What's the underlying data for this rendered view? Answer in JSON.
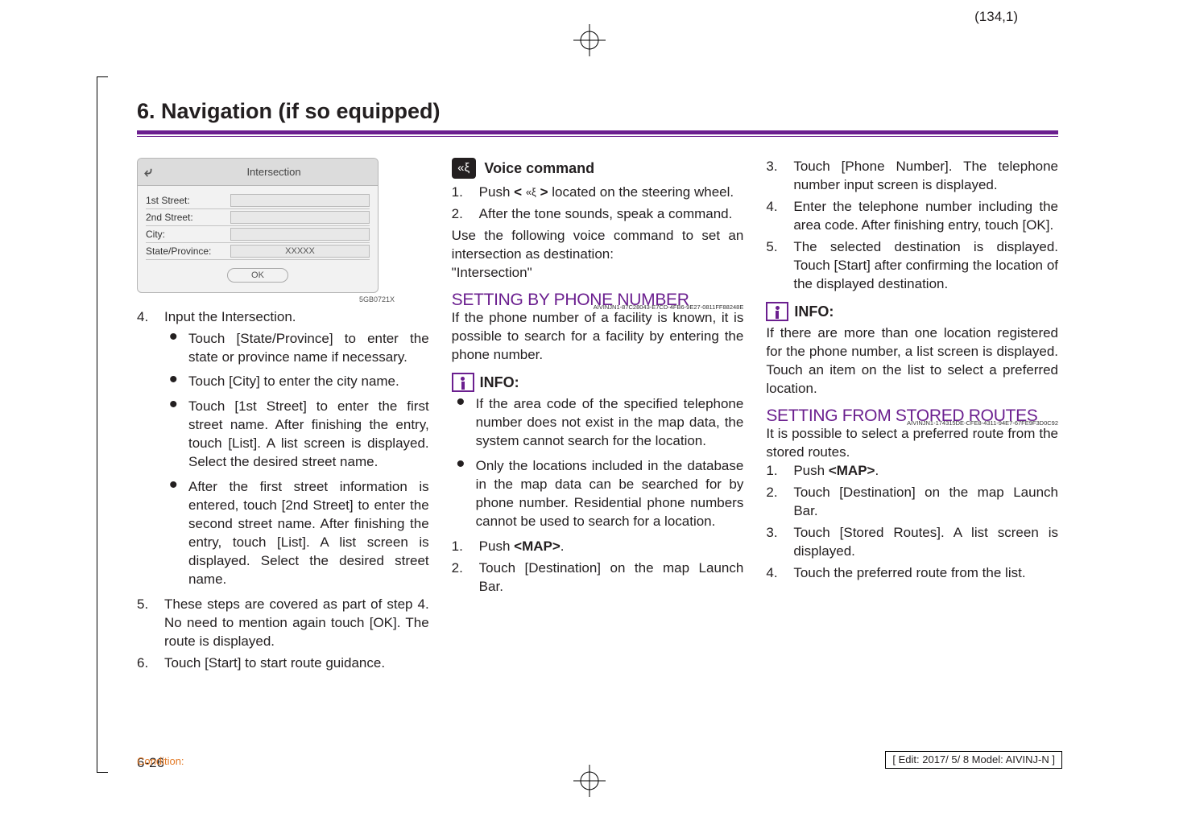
{
  "page_coord": "(134,1)",
  "chapter_title": "6. Navigation (if so equipped)",
  "screenshot": {
    "title": "Intersection",
    "rows": [
      {
        "label": "1st Street:",
        "value": ""
      },
      {
        "label": "2nd Street:",
        "value": ""
      },
      {
        "label": "City:",
        "value": ""
      },
      {
        "label": "State/Province:",
        "value": "XXXXX"
      }
    ],
    "ok": "OK",
    "code": "5GB0721X"
  },
  "col1": {
    "step4": "Input the Intersection.",
    "b1": "Touch [State/Province] to enter the state or province name if necessary.",
    "b2": "Touch [City] to enter the city name.",
    "b3": "Touch [1st Street] to enter the first street name. After finishing the entry, touch [List]. A list screen is displayed. Select the desired street name.",
    "b4": "After the first street information is entered, touch [2nd Street] to enter the second street name. After finishing the entry, touch [List]. A list screen is displayed. Select the desired street name.",
    "step5": "These steps are covered as part of step 4. No need to mention again touch [OK]. The route is displayed.",
    "step6": "Touch [Start] to start route guidance."
  },
  "col2": {
    "voice_heading": "Voice command",
    "v1a": "Push ",
    "v1b": "< ",
    "v1c": " >",
    "v1d": " located on the steering wheel.",
    "v2": "After the tone sounds, speak a command.",
    "vp": "Use the following voice command to set an intersection as destination:",
    "vcmd": "\"Intersection\"",
    "sec_phone": "SETTING BY PHONE NUMBER",
    "sec_phone_code": "AIVINJN1-87C28043-E7CD-4FB6-9E27-0811FF88248E",
    "phone_intro": "If the phone number of a facility is known, it is possible to search for a facility by entering the phone number.",
    "info": "INFO:",
    "info_b1": "If the area code of the specified telephone number does not exist in the map data, the system cannot search for the location.",
    "info_b2": "Only the locations included in the database in the map data can be searched for by phone number. Residential phone numbers cannot be used to search for a location.",
    "p1a": "Push ",
    "p1b": "<MAP>",
    "p1c": ".",
    "p2": "Touch [Destination] on the map Launch Bar."
  },
  "col3": {
    "p3": "Touch [Phone Number]. The telephone number input screen is displayed.",
    "p4": "Enter the telephone number including the area code. After finishing entry, touch [OK].",
    "p5": "The selected destination is displayed. Touch [Start] after confirming the location of the displayed destination.",
    "info": "INFO:",
    "info_text": "If there are more than one location registered for the phone number, a list screen is displayed. Touch an item on the list to select a preferred location.",
    "sec_stored": "SETTING FROM STORED ROUTES",
    "sec_stored_code": "AIVINJN1-174315DE-CFE8-4311-94E7-67FE9F3D0C92",
    "stored_intro": "It is possible to select a preferred route from the stored routes.",
    "s1a": "Push ",
    "s1b": "<MAP>",
    "s1c": ".",
    "s2": "Touch [Destination] on the map Launch Bar.",
    "s3": "Touch [Stored Routes]. A list screen is displayed.",
    "s4": "Touch the preferred route from the list."
  },
  "page_number": "6-26",
  "footer_condition": "Condition:",
  "footer_edit": "[ Edit: 2017/ 5/ 8    Model:  AIVINJ-N ]"
}
